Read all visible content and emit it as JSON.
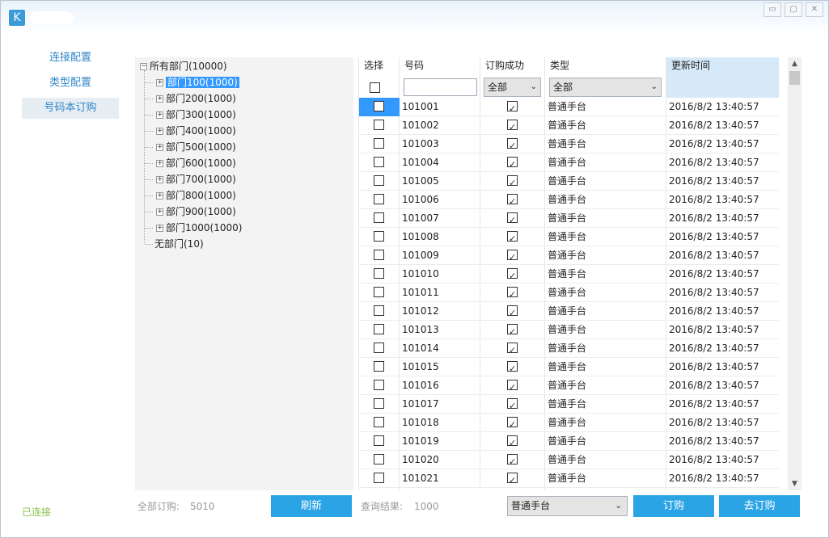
{
  "window": {
    "controls": [
      "▭",
      "▢",
      "✕"
    ]
  },
  "nav": {
    "items": [
      {
        "label": "连接配置",
        "active": false
      },
      {
        "label": "类型配置",
        "active": false
      },
      {
        "label": "号码本订购",
        "active": true
      }
    ]
  },
  "status": {
    "connection": "已连接"
  },
  "tree": {
    "root": "所有部门(10000)",
    "children": [
      "部门100(1000)",
      "部门200(1000)",
      "部门300(1000)",
      "部门400(1000)",
      "部门500(1000)",
      "部门600(1000)",
      "部门700(1000)",
      "部门800(1000)",
      "部门900(1000)",
      "部门1000(1000)"
    ],
    "selected_index": 0,
    "no_dept": "无部门(10)"
  },
  "grid": {
    "headers": {
      "select": "选择",
      "number": "号码",
      "success": "订购成功",
      "type": "类型",
      "time": "更新时间"
    },
    "filters": {
      "number_value": "",
      "success_value": "全部",
      "type_value": "全部"
    },
    "rows": [
      {
        "number": "101001",
        "checked": false,
        "success": true,
        "type": "普通手台",
        "time": "2016/8/2 13:40:57"
      },
      {
        "number": "101002",
        "checked": false,
        "success": true,
        "type": "普通手台",
        "time": "2016/8/2 13:40:57"
      },
      {
        "number": "101003",
        "checked": false,
        "success": true,
        "type": "普通手台",
        "time": "2016/8/2 13:40:57"
      },
      {
        "number": "101004",
        "checked": false,
        "success": true,
        "type": "普通手台",
        "time": "2016/8/2 13:40:57"
      },
      {
        "number": "101005",
        "checked": false,
        "success": true,
        "type": "普通手台",
        "time": "2016/8/2 13:40:57"
      },
      {
        "number": "101006",
        "checked": false,
        "success": true,
        "type": "普通手台",
        "time": "2016/8/2 13:40:57"
      },
      {
        "number": "101007",
        "checked": false,
        "success": true,
        "type": "普通手台",
        "time": "2016/8/2 13:40:57"
      },
      {
        "number": "101008",
        "checked": false,
        "success": true,
        "type": "普通手台",
        "time": "2016/8/2 13:40:57"
      },
      {
        "number": "101009",
        "checked": false,
        "success": true,
        "type": "普通手台",
        "time": "2016/8/2 13:40:57"
      },
      {
        "number": "101010",
        "checked": false,
        "success": true,
        "type": "普通手台",
        "time": "2016/8/2 13:40:57"
      },
      {
        "number": "101011",
        "checked": false,
        "success": true,
        "type": "普通手台",
        "time": "2016/8/2 13:40:57"
      },
      {
        "number": "101012",
        "checked": false,
        "success": true,
        "type": "普通手台",
        "time": "2016/8/2 13:40:57"
      },
      {
        "number": "101013",
        "checked": false,
        "success": true,
        "type": "普通手台",
        "time": "2016/8/2 13:40:57"
      },
      {
        "number": "101014",
        "checked": false,
        "success": true,
        "type": "普通手台",
        "time": "2016/8/2 13:40:57"
      },
      {
        "number": "101015",
        "checked": false,
        "success": true,
        "type": "普通手台",
        "time": "2016/8/2 13:40:57"
      },
      {
        "number": "101016",
        "checked": false,
        "success": true,
        "type": "普通手台",
        "time": "2016/8/2 13:40:57"
      },
      {
        "number": "101017",
        "checked": false,
        "success": true,
        "type": "普通手台",
        "time": "2016/8/2 13:40:57"
      },
      {
        "number": "101018",
        "checked": false,
        "success": true,
        "type": "普通手台",
        "time": "2016/8/2 13:40:57"
      },
      {
        "number": "101019",
        "checked": false,
        "success": true,
        "type": "普通手台",
        "time": "2016/8/2 13:40:57"
      },
      {
        "number": "101020",
        "checked": false,
        "success": true,
        "type": "普通手台",
        "time": "2016/8/2 13:40:57"
      },
      {
        "number": "101021",
        "checked": false,
        "success": true,
        "type": "普通手台",
        "time": "2016/8/2 13:40:57"
      }
    ]
  },
  "footer": {
    "total_label": "全部订购:",
    "total_value": "5010",
    "refresh_label": "刷新",
    "query_label": "查询结果:",
    "query_value": "1000",
    "type_select_value": "普通手台",
    "order_label": "订购",
    "unorder_label": "去订购"
  },
  "colors": {
    "accent": "#2ba4e5",
    "nav_text": "#2f86c8",
    "status_ok": "#8bc34a",
    "selection": "#3399ff",
    "time_header_bg": "#d6e9f8"
  }
}
